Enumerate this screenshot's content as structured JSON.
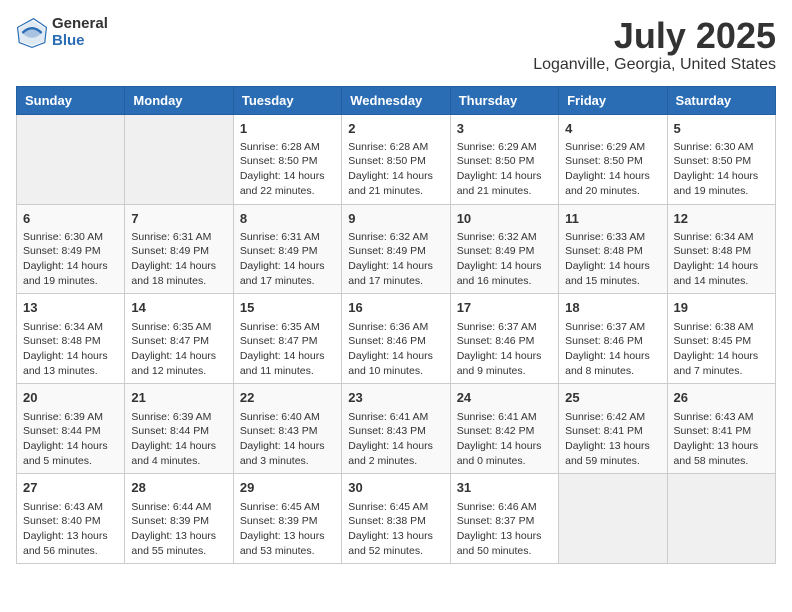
{
  "header": {
    "logo_general": "General",
    "logo_blue": "Blue",
    "title": "July 2025",
    "subtitle": "Loganville, Georgia, United States"
  },
  "days_of_week": [
    "Sunday",
    "Monday",
    "Tuesday",
    "Wednesday",
    "Thursday",
    "Friday",
    "Saturday"
  ],
  "weeks": [
    [
      {
        "day": "",
        "sunrise": "",
        "sunset": "",
        "daylight": ""
      },
      {
        "day": "",
        "sunrise": "",
        "sunset": "",
        "daylight": ""
      },
      {
        "day": "1",
        "sunrise": "Sunrise: 6:28 AM",
        "sunset": "Sunset: 8:50 PM",
        "daylight": "Daylight: 14 hours and 22 minutes."
      },
      {
        "day": "2",
        "sunrise": "Sunrise: 6:28 AM",
        "sunset": "Sunset: 8:50 PM",
        "daylight": "Daylight: 14 hours and 21 minutes."
      },
      {
        "day": "3",
        "sunrise": "Sunrise: 6:29 AM",
        "sunset": "Sunset: 8:50 PM",
        "daylight": "Daylight: 14 hours and 21 minutes."
      },
      {
        "day": "4",
        "sunrise": "Sunrise: 6:29 AM",
        "sunset": "Sunset: 8:50 PM",
        "daylight": "Daylight: 14 hours and 20 minutes."
      },
      {
        "day": "5",
        "sunrise": "Sunrise: 6:30 AM",
        "sunset": "Sunset: 8:50 PM",
        "daylight": "Daylight: 14 hours and 19 minutes."
      }
    ],
    [
      {
        "day": "6",
        "sunrise": "Sunrise: 6:30 AM",
        "sunset": "Sunset: 8:49 PM",
        "daylight": "Daylight: 14 hours and 19 minutes."
      },
      {
        "day": "7",
        "sunrise": "Sunrise: 6:31 AM",
        "sunset": "Sunset: 8:49 PM",
        "daylight": "Daylight: 14 hours and 18 minutes."
      },
      {
        "day": "8",
        "sunrise": "Sunrise: 6:31 AM",
        "sunset": "Sunset: 8:49 PM",
        "daylight": "Daylight: 14 hours and 17 minutes."
      },
      {
        "day": "9",
        "sunrise": "Sunrise: 6:32 AM",
        "sunset": "Sunset: 8:49 PM",
        "daylight": "Daylight: 14 hours and 17 minutes."
      },
      {
        "day": "10",
        "sunrise": "Sunrise: 6:32 AM",
        "sunset": "Sunset: 8:49 PM",
        "daylight": "Daylight: 14 hours and 16 minutes."
      },
      {
        "day": "11",
        "sunrise": "Sunrise: 6:33 AM",
        "sunset": "Sunset: 8:48 PM",
        "daylight": "Daylight: 14 hours and 15 minutes."
      },
      {
        "day": "12",
        "sunrise": "Sunrise: 6:34 AM",
        "sunset": "Sunset: 8:48 PM",
        "daylight": "Daylight: 14 hours and 14 minutes."
      }
    ],
    [
      {
        "day": "13",
        "sunrise": "Sunrise: 6:34 AM",
        "sunset": "Sunset: 8:48 PM",
        "daylight": "Daylight: 14 hours and 13 minutes."
      },
      {
        "day": "14",
        "sunrise": "Sunrise: 6:35 AM",
        "sunset": "Sunset: 8:47 PM",
        "daylight": "Daylight: 14 hours and 12 minutes."
      },
      {
        "day": "15",
        "sunrise": "Sunrise: 6:35 AM",
        "sunset": "Sunset: 8:47 PM",
        "daylight": "Daylight: 14 hours and 11 minutes."
      },
      {
        "day": "16",
        "sunrise": "Sunrise: 6:36 AM",
        "sunset": "Sunset: 8:46 PM",
        "daylight": "Daylight: 14 hours and 10 minutes."
      },
      {
        "day": "17",
        "sunrise": "Sunrise: 6:37 AM",
        "sunset": "Sunset: 8:46 PM",
        "daylight": "Daylight: 14 hours and 9 minutes."
      },
      {
        "day": "18",
        "sunrise": "Sunrise: 6:37 AM",
        "sunset": "Sunset: 8:46 PM",
        "daylight": "Daylight: 14 hours and 8 minutes."
      },
      {
        "day": "19",
        "sunrise": "Sunrise: 6:38 AM",
        "sunset": "Sunset: 8:45 PM",
        "daylight": "Daylight: 14 hours and 7 minutes."
      }
    ],
    [
      {
        "day": "20",
        "sunrise": "Sunrise: 6:39 AM",
        "sunset": "Sunset: 8:44 PM",
        "daylight": "Daylight: 14 hours and 5 minutes."
      },
      {
        "day": "21",
        "sunrise": "Sunrise: 6:39 AM",
        "sunset": "Sunset: 8:44 PM",
        "daylight": "Daylight: 14 hours and 4 minutes."
      },
      {
        "day": "22",
        "sunrise": "Sunrise: 6:40 AM",
        "sunset": "Sunset: 8:43 PM",
        "daylight": "Daylight: 14 hours and 3 minutes."
      },
      {
        "day": "23",
        "sunrise": "Sunrise: 6:41 AM",
        "sunset": "Sunset: 8:43 PM",
        "daylight": "Daylight: 14 hours and 2 minutes."
      },
      {
        "day": "24",
        "sunrise": "Sunrise: 6:41 AM",
        "sunset": "Sunset: 8:42 PM",
        "daylight": "Daylight: 14 hours and 0 minutes."
      },
      {
        "day": "25",
        "sunrise": "Sunrise: 6:42 AM",
        "sunset": "Sunset: 8:41 PM",
        "daylight": "Daylight: 13 hours and 59 minutes."
      },
      {
        "day": "26",
        "sunrise": "Sunrise: 6:43 AM",
        "sunset": "Sunset: 8:41 PM",
        "daylight": "Daylight: 13 hours and 58 minutes."
      }
    ],
    [
      {
        "day": "27",
        "sunrise": "Sunrise: 6:43 AM",
        "sunset": "Sunset: 8:40 PM",
        "daylight": "Daylight: 13 hours and 56 minutes."
      },
      {
        "day": "28",
        "sunrise": "Sunrise: 6:44 AM",
        "sunset": "Sunset: 8:39 PM",
        "daylight": "Daylight: 13 hours and 55 minutes."
      },
      {
        "day": "29",
        "sunrise": "Sunrise: 6:45 AM",
        "sunset": "Sunset: 8:39 PM",
        "daylight": "Daylight: 13 hours and 53 minutes."
      },
      {
        "day": "30",
        "sunrise": "Sunrise: 6:45 AM",
        "sunset": "Sunset: 8:38 PM",
        "daylight": "Daylight: 13 hours and 52 minutes."
      },
      {
        "day": "31",
        "sunrise": "Sunrise: 6:46 AM",
        "sunset": "Sunset: 8:37 PM",
        "daylight": "Daylight: 13 hours and 50 minutes."
      },
      {
        "day": "",
        "sunrise": "",
        "sunset": "",
        "daylight": ""
      },
      {
        "day": "",
        "sunrise": "",
        "sunset": "",
        "daylight": ""
      }
    ]
  ]
}
